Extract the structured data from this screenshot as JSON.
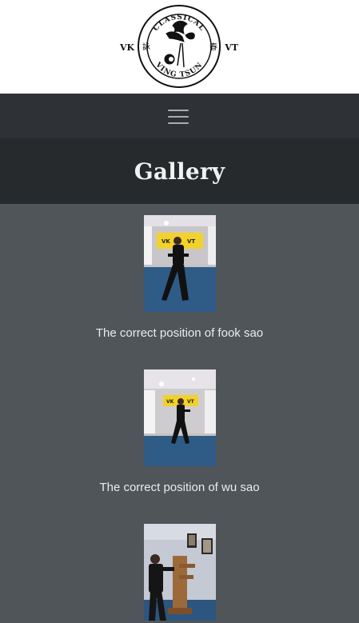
{
  "logo": {
    "ring_top": "CLASSICAL",
    "ring_bottom": "VING TSUN",
    "left": "VK",
    "right": "VT",
    "glyph_left": "詠",
    "glyph_right": "春"
  },
  "nav": {
    "menu_icon": "hamburger-icon"
  },
  "header": {
    "title": "Gallery"
  },
  "gallery": {
    "items": [
      {
        "caption": "The correct position of fook sao"
      },
      {
        "caption": "The correct position of wu sao"
      },
      {
        "caption": ""
      }
    ]
  },
  "colors": {
    "page_bg": "#505559",
    "nav_bg": "#2e3236",
    "title_bg": "#262a2d",
    "banner_yellow": "#f2d22a",
    "floor_blue": "#2f5b87"
  }
}
